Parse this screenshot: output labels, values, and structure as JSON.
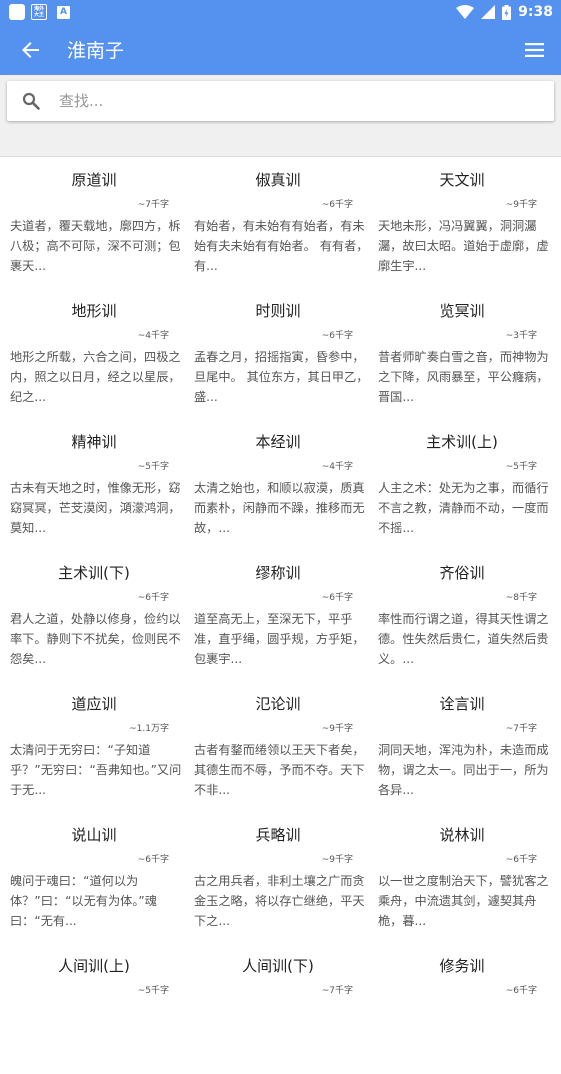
{
  "status_bar": {
    "app_icon_text": "海外\n大王",
    "a_icon_text": "A",
    "time": "9:38"
  },
  "app_bar": {
    "title": "淮南子",
    "back_icon": "arrow-back-icon",
    "menu_icon": "hamburger-menu-icon"
  },
  "search": {
    "placeholder": "查找...",
    "value": ""
  },
  "chapters": [
    {
      "title": "原道训",
      "count": "~7千字",
      "excerpt": "夫道者，覆天载地，廓四方，柝八极；高不可际，深不可测；包裹天..."
    },
    {
      "title": "俶真训",
      "count": "~6千字",
      "excerpt": "有始者，有未始有有始者，有未始有夫未始有有始者。 有有者，有..."
    },
    {
      "title": "天文训",
      "count": "~9千字",
      "excerpt": "天地未形，冯冯翼翼，洞洞灟灟，故曰太昭。道始于虚廓，虚廓生宇..."
    },
    {
      "title": "地形训",
      "count": "~4千字",
      "excerpt": "地形之所载，六合之间，四极之内，照之以日月，经之以星辰，纪之..."
    },
    {
      "title": "时则训",
      "count": "~6千字",
      "excerpt": "孟春之月，招摇指寅，昏参中，旦尾中。 其位东方，其日甲乙，盛..."
    },
    {
      "title": "览冥训",
      "count": "~3千字",
      "excerpt": "昔者师旷奏白雪之音，而神物为之下降，风雨暴至，平公癃病，晋国..."
    },
    {
      "title": "精神训",
      "count": "~5千字",
      "excerpt": "古未有天地之时，惟像无形，窈窈冥冥，芒芠漠闵，澒濛鸿洞，莫知..."
    },
    {
      "title": "本经训",
      "count": "~4千字",
      "excerpt": "太清之始也，和顺以寂漠，质真而素朴，闲静而不躁，推移而无故，..."
    },
    {
      "title": "主术训(上)",
      "count": "~5千字",
      "excerpt": "人主之术：处无为之事，而循行不言之教，清静而不动，一度而不摇..."
    },
    {
      "title": "主术训(下)",
      "count": "~6千字",
      "excerpt": "君人之道，处静以修身，俭约以率下。静则下不扰矣，俭则民不怨矣..."
    },
    {
      "title": "缪称训",
      "count": "~6千字",
      "excerpt": "道至高无上，至深无下，平乎准，直乎绳，圆乎规，方乎矩，包裹宇..."
    },
    {
      "title": "齐俗训",
      "count": "~8千字",
      "excerpt": "率性而行谓之道，得其天性谓之德。性失然后贵仁，道失然后贵义。..."
    },
    {
      "title": "道应训",
      "count": "~1.1万字",
      "excerpt": "太清问于无穷曰：“子知道乎？”无穷曰：“吾弗知也。”又问于无..."
    },
    {
      "title": "氾论训",
      "count": "~9千字",
      "excerpt": "古者有鍪而绻领以王天下者矣，其德生而不辱，予而不夺。天下不非..."
    },
    {
      "title": "诠言训",
      "count": "~7千字",
      "excerpt": "洞同天地，浑沌为朴，未造而成物，谓之太一。同出于一，所为各异..."
    },
    {
      "title": "说山训",
      "count": "~6千字",
      "excerpt": "魄问于魂曰：“道何以为体？”曰：“以无有为体。”魂曰：“无有..."
    },
    {
      "title": "兵略训",
      "count": "~9千字",
      "excerpt": "古之用兵者，非利土壤之广而贪金玉之略，将以存亡继绝，平天下之..."
    },
    {
      "title": "说林训",
      "count": "~6千字",
      "excerpt": "以一世之度制治天下，譬犹客之乘舟，中流遗其剑，遽契其舟桅，暮..."
    },
    {
      "title": "人间训(上)",
      "count": "~5千字",
      "excerpt": ""
    },
    {
      "title": "人间训(下)",
      "count": "~7千字",
      "excerpt": ""
    },
    {
      "title": "修务训",
      "count": "~6千字",
      "excerpt": ""
    }
  ],
  "colors": {
    "primary": "#5591ee",
    "background": "#ffffff",
    "search_band": "#f0f0f0"
  }
}
